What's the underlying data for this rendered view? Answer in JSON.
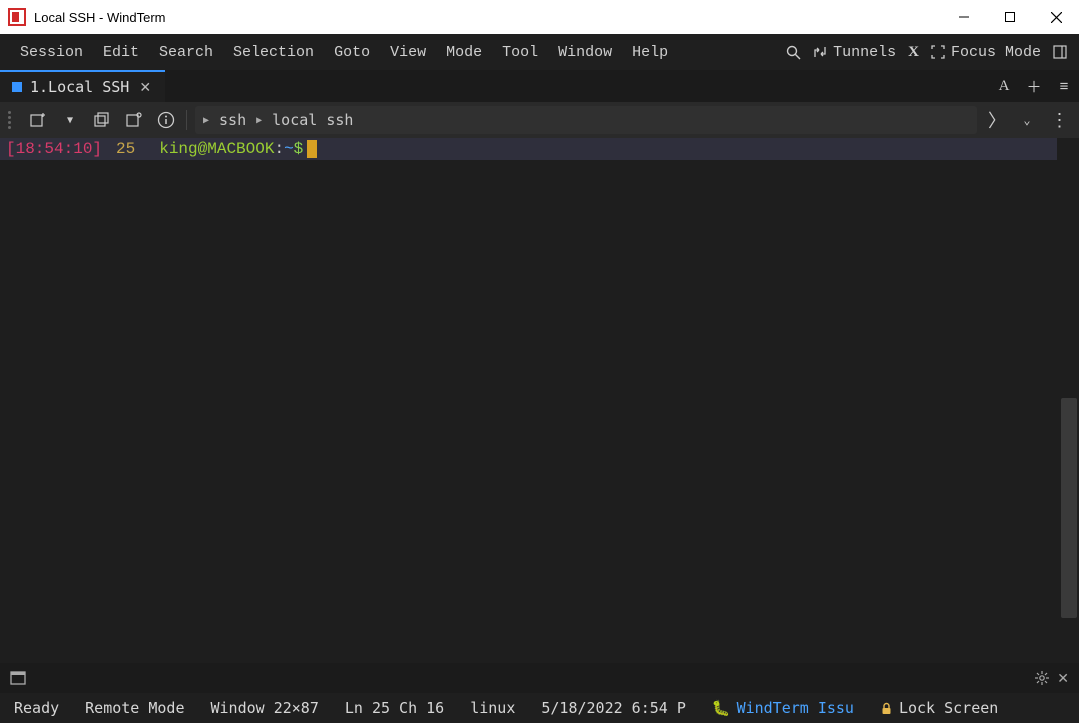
{
  "window": {
    "title": "Local SSH - WindTerm"
  },
  "menu": {
    "items": [
      "Session",
      "Edit",
      "Search",
      "Selection",
      "Goto",
      "View",
      "Mode",
      "Tool",
      "Window",
      "Help"
    ],
    "tunnels": "Tunnels",
    "x": "X",
    "focus_mode": "Focus Mode"
  },
  "tab": {
    "label": "1.Local SSH"
  },
  "path": {
    "seg1": "ssh",
    "seg2": "local ssh"
  },
  "terminal": {
    "timestamp": "[18:54:10]",
    "lineno": "25",
    "user": "king",
    "at": "@",
    "host": "MACBOOK",
    "colon": ":",
    "path": "~",
    "dollar": "$"
  },
  "status": {
    "ready": "Ready",
    "remote": "Remote Mode",
    "window": "Window 22×87",
    "lncol": "Ln 25 Ch 16",
    "os": "linux",
    "datetime": "5/18/2022 6:54 P",
    "issue": "WindTerm Issu",
    "lock": "Lock Screen"
  }
}
